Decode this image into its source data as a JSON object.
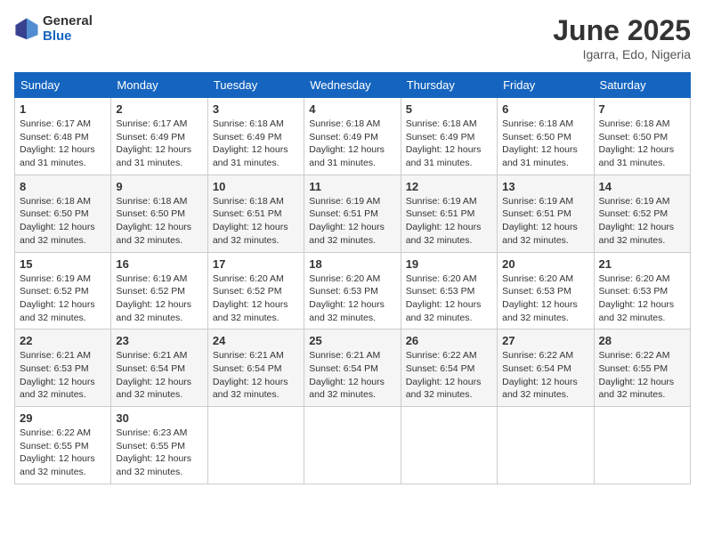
{
  "header": {
    "logo_general": "General",
    "logo_blue": "Blue",
    "month_year": "June 2025",
    "location": "Igarra, Edo, Nigeria"
  },
  "days_of_week": [
    "Sunday",
    "Monday",
    "Tuesday",
    "Wednesday",
    "Thursday",
    "Friday",
    "Saturday"
  ],
  "weeks": [
    [
      {
        "day": 1,
        "sunrise": "6:17 AM",
        "sunset": "6:48 PM",
        "daylight": "12 hours and 31 minutes."
      },
      {
        "day": 2,
        "sunrise": "6:17 AM",
        "sunset": "6:49 PM",
        "daylight": "12 hours and 31 minutes."
      },
      {
        "day": 3,
        "sunrise": "6:18 AM",
        "sunset": "6:49 PM",
        "daylight": "12 hours and 31 minutes."
      },
      {
        "day": 4,
        "sunrise": "6:18 AM",
        "sunset": "6:49 PM",
        "daylight": "12 hours and 31 minutes."
      },
      {
        "day": 5,
        "sunrise": "6:18 AM",
        "sunset": "6:49 PM",
        "daylight": "12 hours and 31 minutes."
      },
      {
        "day": 6,
        "sunrise": "6:18 AM",
        "sunset": "6:50 PM",
        "daylight": "12 hours and 31 minutes."
      },
      {
        "day": 7,
        "sunrise": "6:18 AM",
        "sunset": "6:50 PM",
        "daylight": "12 hours and 31 minutes."
      }
    ],
    [
      {
        "day": 8,
        "sunrise": "6:18 AM",
        "sunset": "6:50 PM",
        "daylight": "12 hours and 32 minutes."
      },
      {
        "day": 9,
        "sunrise": "6:18 AM",
        "sunset": "6:50 PM",
        "daylight": "12 hours and 32 minutes."
      },
      {
        "day": 10,
        "sunrise": "6:18 AM",
        "sunset": "6:51 PM",
        "daylight": "12 hours and 32 minutes."
      },
      {
        "day": 11,
        "sunrise": "6:19 AM",
        "sunset": "6:51 PM",
        "daylight": "12 hours and 32 minutes."
      },
      {
        "day": 12,
        "sunrise": "6:19 AM",
        "sunset": "6:51 PM",
        "daylight": "12 hours and 32 minutes."
      },
      {
        "day": 13,
        "sunrise": "6:19 AM",
        "sunset": "6:51 PM",
        "daylight": "12 hours and 32 minutes."
      },
      {
        "day": 14,
        "sunrise": "6:19 AM",
        "sunset": "6:52 PM",
        "daylight": "12 hours and 32 minutes."
      }
    ],
    [
      {
        "day": 15,
        "sunrise": "6:19 AM",
        "sunset": "6:52 PM",
        "daylight": "12 hours and 32 minutes."
      },
      {
        "day": 16,
        "sunrise": "6:19 AM",
        "sunset": "6:52 PM",
        "daylight": "12 hours and 32 minutes."
      },
      {
        "day": 17,
        "sunrise": "6:20 AM",
        "sunset": "6:52 PM",
        "daylight": "12 hours and 32 minutes."
      },
      {
        "day": 18,
        "sunrise": "6:20 AM",
        "sunset": "6:53 PM",
        "daylight": "12 hours and 32 minutes."
      },
      {
        "day": 19,
        "sunrise": "6:20 AM",
        "sunset": "6:53 PM",
        "daylight": "12 hours and 32 minutes."
      },
      {
        "day": 20,
        "sunrise": "6:20 AM",
        "sunset": "6:53 PM",
        "daylight": "12 hours and 32 minutes."
      },
      {
        "day": 21,
        "sunrise": "6:20 AM",
        "sunset": "6:53 PM",
        "daylight": "12 hours and 32 minutes."
      }
    ],
    [
      {
        "day": 22,
        "sunrise": "6:21 AM",
        "sunset": "6:53 PM",
        "daylight": "12 hours and 32 minutes."
      },
      {
        "day": 23,
        "sunrise": "6:21 AM",
        "sunset": "6:54 PM",
        "daylight": "12 hours and 32 minutes."
      },
      {
        "day": 24,
        "sunrise": "6:21 AM",
        "sunset": "6:54 PM",
        "daylight": "12 hours and 32 minutes."
      },
      {
        "day": 25,
        "sunrise": "6:21 AM",
        "sunset": "6:54 PM",
        "daylight": "12 hours and 32 minutes."
      },
      {
        "day": 26,
        "sunrise": "6:22 AM",
        "sunset": "6:54 PM",
        "daylight": "12 hours and 32 minutes."
      },
      {
        "day": 27,
        "sunrise": "6:22 AM",
        "sunset": "6:54 PM",
        "daylight": "12 hours and 32 minutes."
      },
      {
        "day": 28,
        "sunrise": "6:22 AM",
        "sunset": "6:55 PM",
        "daylight": "12 hours and 32 minutes."
      }
    ],
    [
      {
        "day": 29,
        "sunrise": "6:22 AM",
        "sunset": "6:55 PM",
        "daylight": "12 hours and 32 minutes."
      },
      {
        "day": 30,
        "sunrise": "6:23 AM",
        "sunset": "6:55 PM",
        "daylight": "12 hours and 32 minutes."
      },
      null,
      null,
      null,
      null,
      null
    ]
  ]
}
